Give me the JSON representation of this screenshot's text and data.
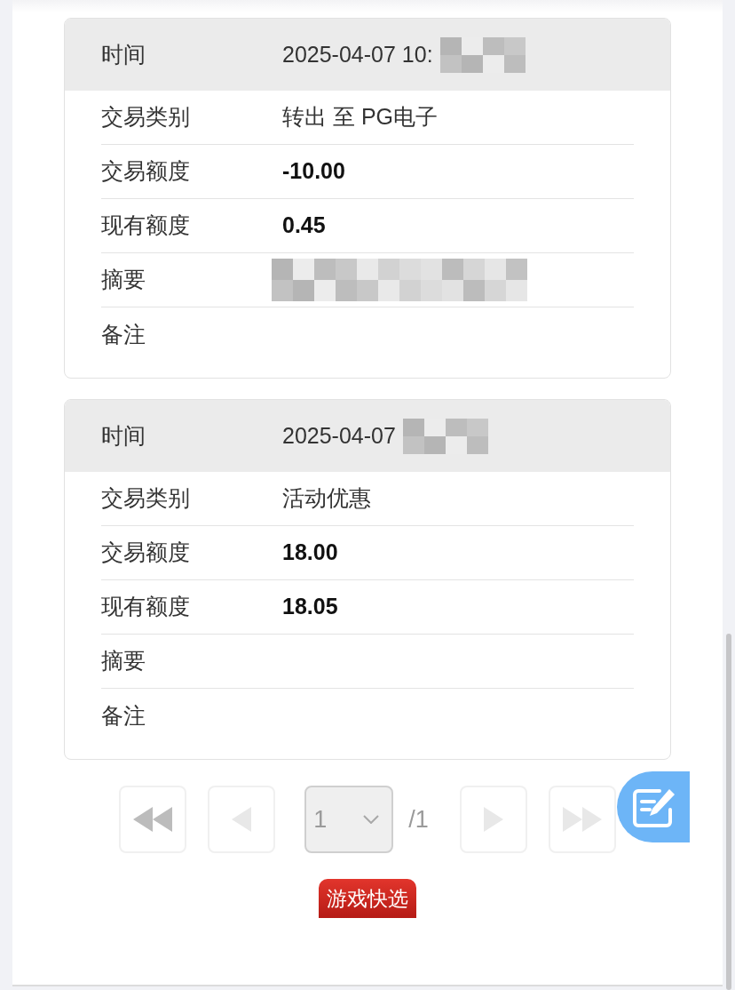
{
  "records": [
    {
      "header": {
        "label": "时间",
        "value": "2025-04-07 10:",
        "redacted": true
      },
      "rows": [
        {
          "label": "交易类别",
          "value": "转出 至 PG电子",
          "kind": "text"
        },
        {
          "label": "交易额度",
          "value": "-10.00",
          "kind": "amount"
        },
        {
          "label": "现有额度",
          "value": "0.45",
          "kind": "amount"
        },
        {
          "label": "摘要",
          "kind": "redacted"
        },
        {
          "label": "备注",
          "kind": "empty"
        }
      ]
    },
    {
      "header": {
        "label": "时间",
        "value": "2025-04-07",
        "redacted": true
      },
      "rows": [
        {
          "label": "交易类别",
          "value": "活动优惠",
          "kind": "text"
        },
        {
          "label": "交易额度",
          "value": "18.00",
          "kind": "amount"
        },
        {
          "label": "现有额度",
          "value": "18.05",
          "kind": "amount"
        },
        {
          "label": "摘要",
          "kind": "empty"
        },
        {
          "label": "备注",
          "kind": "empty"
        }
      ]
    }
  ],
  "pagination": [
    {
      "kind": "first",
      "disabled": false
    },
    {
      "kind": "prev",
      "disabled": true
    },
    {
      "kind": "select",
      "value": "1",
      "disabled": true
    },
    {
      "kind": "total",
      "text": "/1"
    },
    {
      "kind": "next",
      "disabled": true
    },
    {
      "kind": "last",
      "disabled": true
    }
  ],
  "quick_button": {
    "label": "游戏快选"
  }
}
